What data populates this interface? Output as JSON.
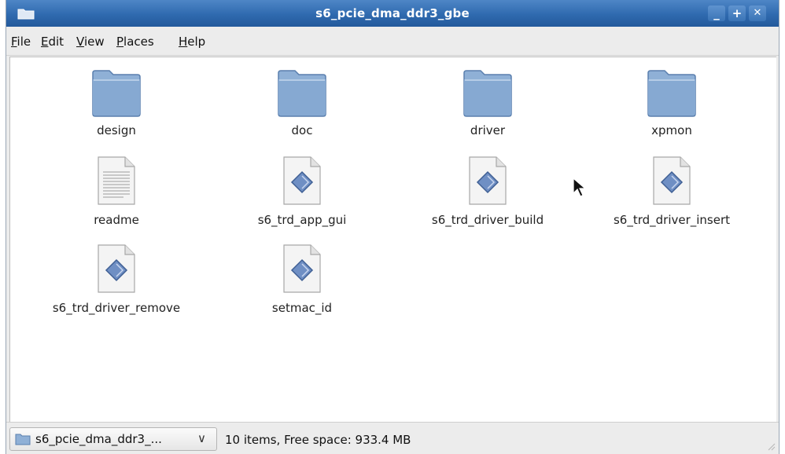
{
  "window": {
    "title": "s6_pcie_dma_ddr3_gbe"
  },
  "titlebar": {
    "minimize": "_",
    "maximize": "+",
    "close": "✕"
  },
  "menu": [
    {
      "pre": "",
      "u": "F",
      "post": "ile"
    },
    {
      "pre": "",
      "u": "E",
      "post": "dit"
    },
    {
      "pre": "",
      "u": "V",
      "post": "iew"
    },
    {
      "pre": "",
      "u": "P",
      "post": "laces"
    },
    {
      "pre": "",
      "u": "H",
      "post": "elp"
    }
  ],
  "items": [
    {
      "name": "design",
      "type": "folder"
    },
    {
      "name": "doc",
      "type": "folder"
    },
    {
      "name": "driver",
      "type": "folder"
    },
    {
      "name": "xpmon",
      "type": "folder"
    },
    {
      "name": "readme",
      "type": "text-file"
    },
    {
      "name": "s6_trd_app_gui",
      "type": "script-file"
    },
    {
      "name": "s6_trd_driver_build",
      "type": "script-file"
    },
    {
      "name": "s6_trd_driver_insert",
      "type": "script-file"
    },
    {
      "name": "s6_trd_driver_remove",
      "type": "script-file"
    },
    {
      "name": "setmac_id",
      "type": "script-file"
    }
  ],
  "status": {
    "location": "s6_pcie_dma_ddr3_...",
    "arrow": "∨",
    "text": "10 items, Free space: 933.4 MB"
  }
}
